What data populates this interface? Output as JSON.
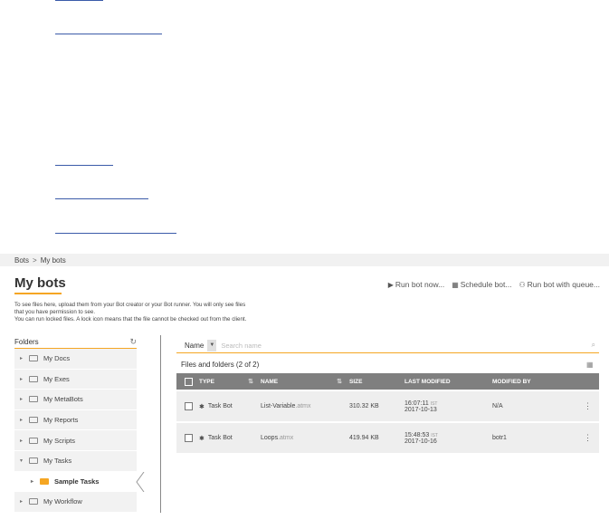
{
  "breadcrumb": {
    "root": "Bots",
    "sep": ">",
    "current": "My bots"
  },
  "page": {
    "title": "My bots"
  },
  "actions": [
    {
      "icon": "play-icon",
      "glyph": "▶",
      "label": "Run bot now..."
    },
    {
      "icon": "calendar-icon",
      "glyph": "▦",
      "label": "Schedule bot..."
    },
    {
      "icon": "queue-icon",
      "glyph": "⚇",
      "label": "Run bot with queue..."
    }
  ],
  "help": {
    "line1": "To see files here, upload them from your Bot creator or your Bot runner. You will only see files",
    "line2": "that you have permission to see.",
    "line3": "You can run locked files. A lock icon means that the file cannot be checked out from the client."
  },
  "folders": {
    "title": "Folders",
    "items": [
      {
        "label": "My Docs"
      },
      {
        "label": "My Exes"
      },
      {
        "label": "My MetaBots"
      },
      {
        "label": "My Reports"
      },
      {
        "label": "My Scripts"
      },
      {
        "label": "My Tasks"
      },
      {
        "label": "Sample Tasks"
      },
      {
        "label": "My Workflow"
      }
    ]
  },
  "search": {
    "field": "Name",
    "placeholder": "Search name"
  },
  "files": {
    "title": "Files and folders (2 of 2)",
    "columns": {
      "type": "TYPE",
      "name": "NAME",
      "size": "SIZE",
      "modified": "LAST MODIFIED",
      "by": "MODIFIED BY"
    },
    "rows": [
      {
        "type": "Task Bot",
        "name": "List-Variable",
        "ext": ".atmx",
        "size": "310.32 KB",
        "time": "16:07:11",
        "tz": "IST",
        "date": "2017-10-13",
        "by": "N/A"
      },
      {
        "type": "Task Bot",
        "name": "Loops",
        "ext": ".atmx",
        "size": "419.94 KB",
        "time": "15:48:53",
        "tz": "IST",
        "date": "2017-10-16",
        "by": "botr1"
      }
    ]
  },
  "colors": {
    "accent": "#f5a623",
    "link": "#3b5ba9",
    "header_gray": "#7f7f7f"
  }
}
